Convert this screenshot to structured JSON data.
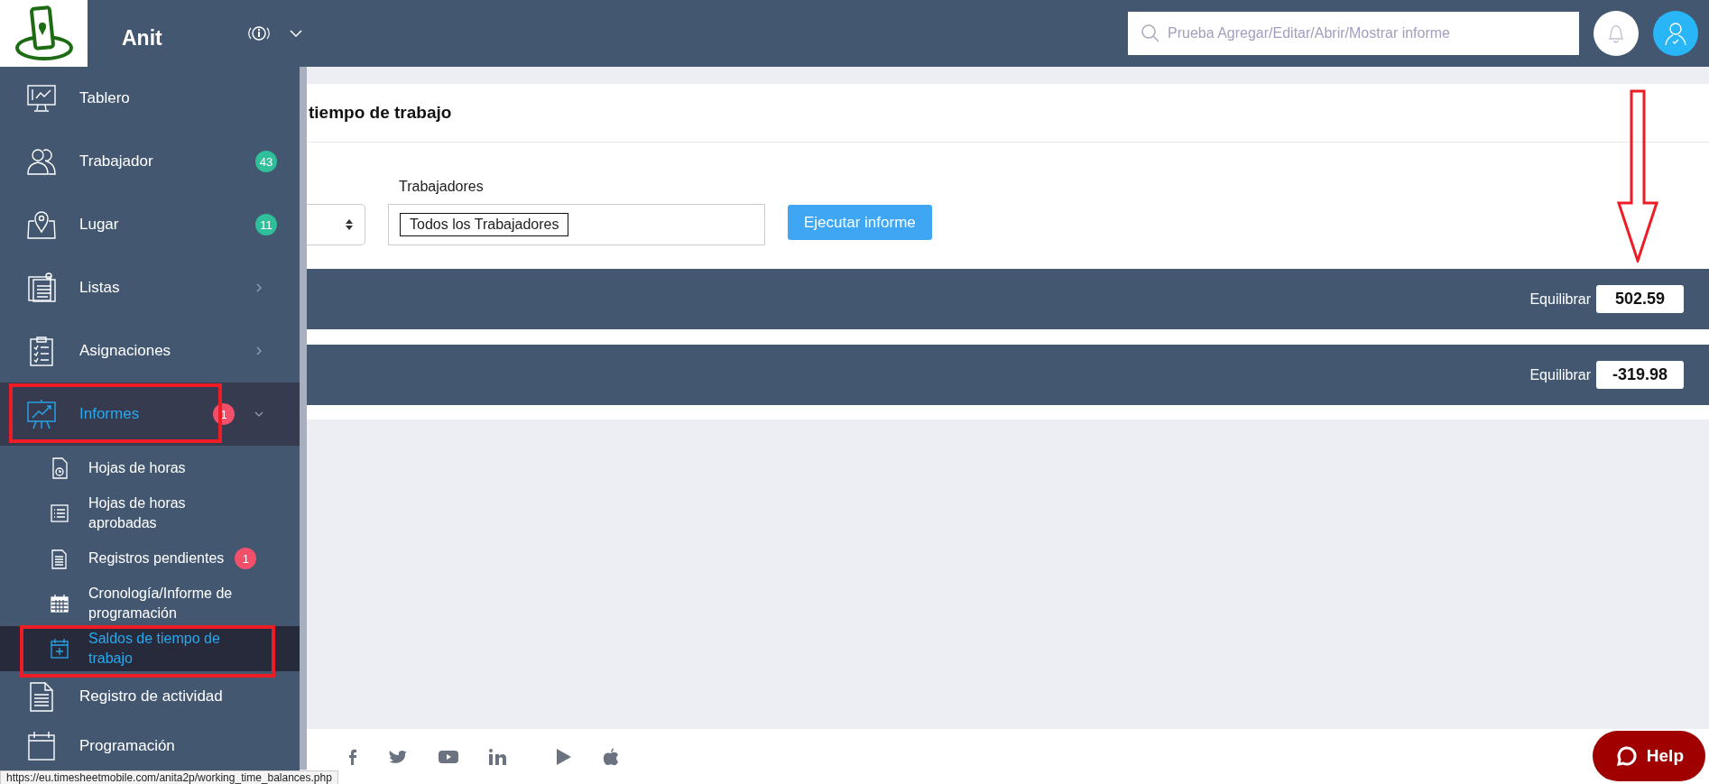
{
  "header": {
    "brand": "Anit",
    "search": {
      "placeholder": "Prueba Agregar/Editar/Abrir/Mostrar informe"
    }
  },
  "sidebar": {
    "items": [
      {
        "label": "Tablero",
        "selected": false
      },
      {
        "label": "Trabajador",
        "selected": false,
        "badge": {
          "text": "43",
          "color": "#2fbf9b"
        }
      },
      {
        "label": "Lugar",
        "selected": false,
        "badge": {
          "text": "11",
          "color": "#2fbf9b"
        }
      },
      {
        "label": "Listas",
        "selected": false,
        "expanded": false
      },
      {
        "label": "Asignaciones",
        "selected": false,
        "expanded": false
      },
      {
        "label": "Informes",
        "selected": true,
        "expanded": true,
        "badge": {
          "text": "1",
          "color": "#f0506a"
        },
        "children": [
          {
            "label": "Hojas de horas",
            "selected": false
          },
          {
            "label": "Hojas de horas aprobadas",
            "selected": false
          },
          {
            "label": "Registros pendientes",
            "selected": false,
            "badge": {
              "text": "1",
              "color": "#f0506a"
            }
          },
          {
            "label": "Cronología/Informe de programación",
            "selected": false
          },
          {
            "label": "Saldos de tiempo de trabajo",
            "selected": true
          }
        ]
      },
      {
        "label": "Registro de actividad",
        "selected": false
      },
      {
        "label": "Programación",
        "selected": false
      }
    ]
  },
  "page_title": "tiempo de trabajo",
  "filters": {
    "workers_label": "Trabajadores",
    "workers_token": "Todos los Trabajadores",
    "run_button": "Ejecutar informe"
  },
  "balances": [
    {
      "label": "Equilibrar",
      "value": "502.59"
    },
    {
      "label": "Equilibrar",
      "value": "-319.98"
    }
  ],
  "footer": {
    "help_button": "Help"
  },
  "status_url": "https://eu.timesheetmobile.com/anita2p/working_time_balances.php"
}
